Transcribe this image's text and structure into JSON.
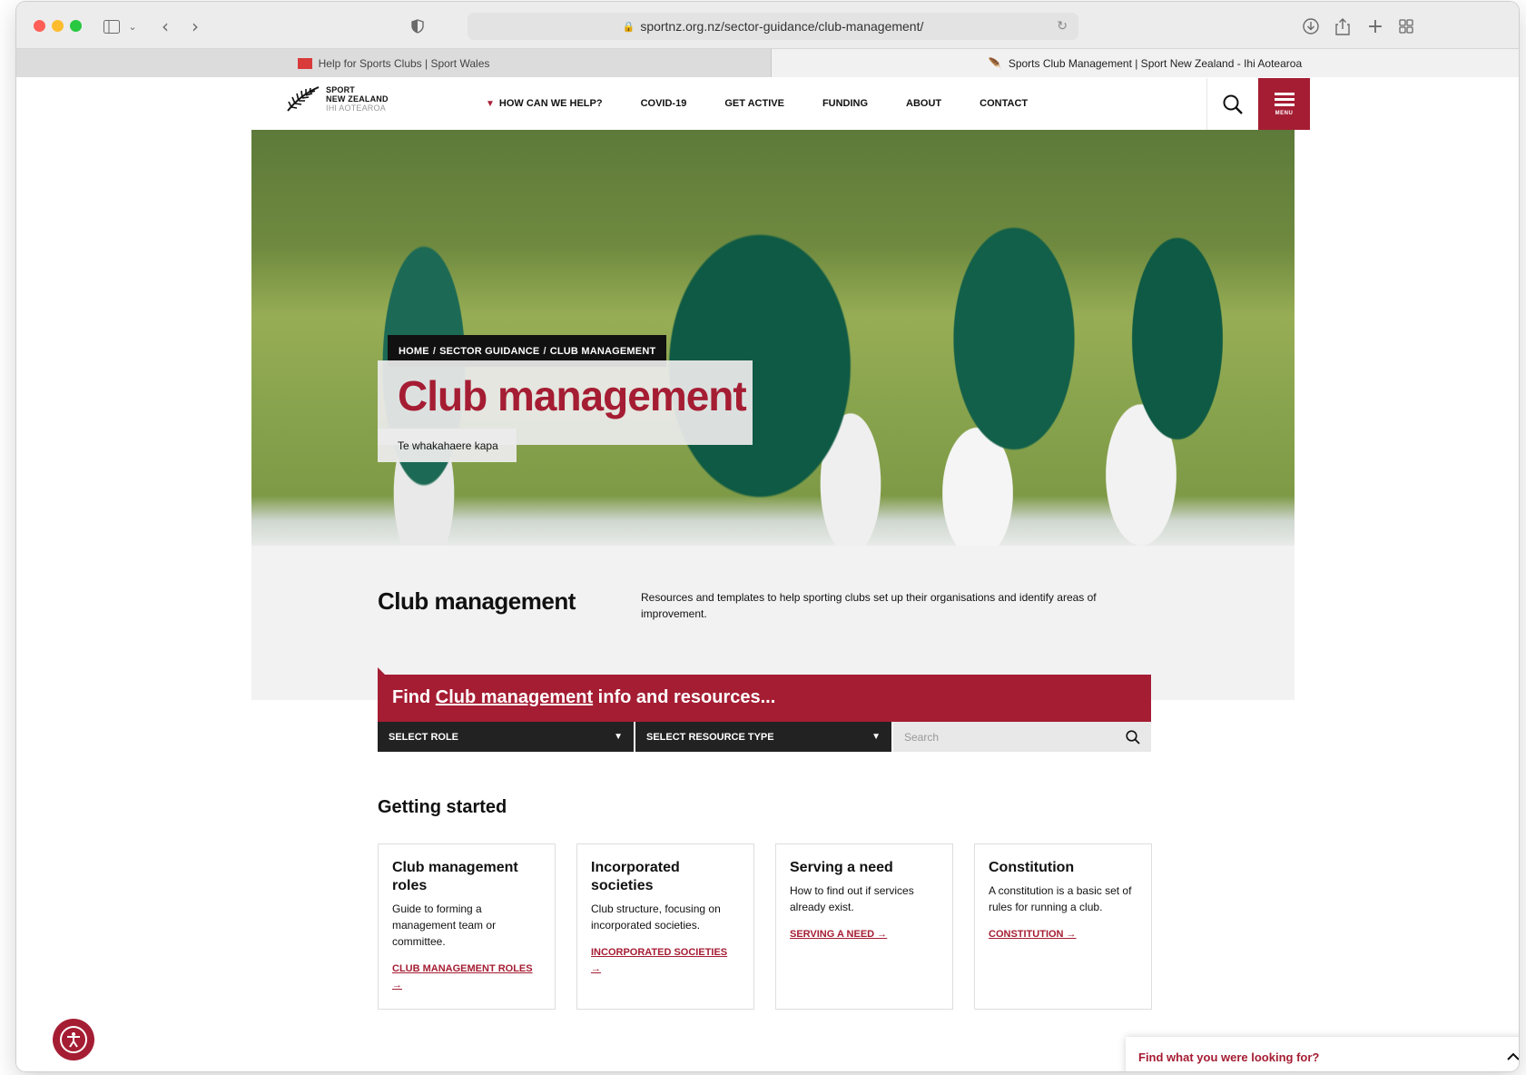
{
  "browser": {
    "url": "sportnz.org.nz/sector-guidance/club-management/",
    "tabs": [
      {
        "title": "Help for Sports Clubs | Sport Wales",
        "active": false
      },
      {
        "title": "Sports Club Management | Sport New Zealand - Ihi Aotearoa",
        "active": true
      }
    ],
    "traffic_lights": {
      "close": "#ff5f57",
      "minimize": "#febc2e",
      "zoom": "#28c840"
    }
  },
  "header": {
    "logo": {
      "line1": "SPORT",
      "line2": "NEW ZEALAND",
      "line3": "IHI AOTEAROA"
    },
    "nav": [
      "HOW CAN WE HELP?",
      "COVID-19",
      "GET ACTIVE",
      "FUNDING",
      "ABOUT",
      "CONTACT"
    ],
    "menu_label": "MENU"
  },
  "hero": {
    "breadcrumb": {
      "home": "HOME",
      "sep": "/",
      "section": "SECTOR GUIDANCE",
      "current": "CLUB MANAGEMENT"
    },
    "title": "Club management",
    "subtitle": "Te whakahaere kapa"
  },
  "intro": {
    "heading": "Club management",
    "text": "Resources and templates to help sporting clubs set up their organisations and identify areas of improvement."
  },
  "finder": {
    "prefix": "Find ",
    "topic": "Club management",
    "suffix": " info and resources...",
    "role_label": "SELECT ROLE",
    "resource_label": "SELECT RESOURCE TYPE",
    "search_placeholder": "Search"
  },
  "getting_started": {
    "heading": "Getting started",
    "cards": [
      {
        "title": "Club management roles",
        "text": "Guide to forming a management team or committee.",
        "link": "CLUB MANAGEMENT ROLES →"
      },
      {
        "title": "Incorporated societies",
        "text": "Club structure, focusing on incorporated societies.",
        "link": "INCORPORATED SOCIETIES →"
      },
      {
        "title": "Serving a need",
        "text": "How to find out if services already exist.",
        "link": "SERVING A NEED →"
      },
      {
        "title": "Constitution",
        "text": "A constitution is a basic set of rules for running a club.",
        "link": "CONSTITUTION →"
      }
    ]
  },
  "find_bar": {
    "label": "Find what you were looking for?"
  },
  "colors": {
    "brand_red": "#a51d33",
    "dark": "#222222"
  }
}
